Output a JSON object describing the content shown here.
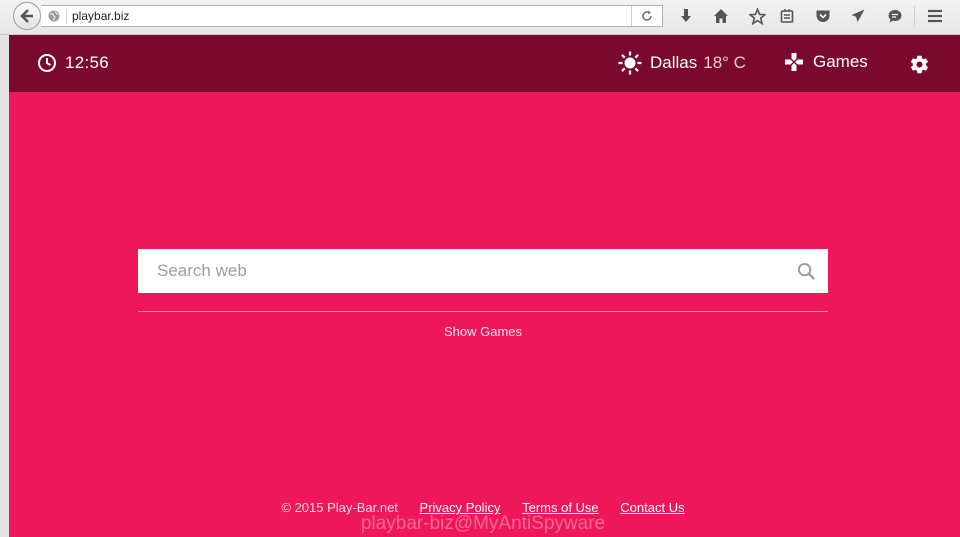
{
  "browser": {
    "url": "playbar.biz",
    "icons": [
      "back-arrow-icon",
      "globe-icon",
      "reload-icon",
      "download-icon",
      "home-icon",
      "bookmark-star-icon",
      "reading-list-icon",
      "pocket-icon",
      "send-icon",
      "chat-icon",
      "menu-icon"
    ]
  },
  "topbar": {
    "time": "12:56",
    "city": "Dallas",
    "temperature": "18° C",
    "games_label": "Games"
  },
  "search": {
    "placeholder": "Search web"
  },
  "main": {
    "show_games": "Show Games"
  },
  "footer": {
    "copyright": "© 2015 Play-Bar.net",
    "privacy": "Privacy Policy",
    "terms": "Terms of Use",
    "contact": "Contact Us"
  },
  "watermark": "playbar-biz@MyAntiSpyware",
  "colors": {
    "page_bg": "#ef175c",
    "topbar_bg": "#7a0a2d"
  }
}
